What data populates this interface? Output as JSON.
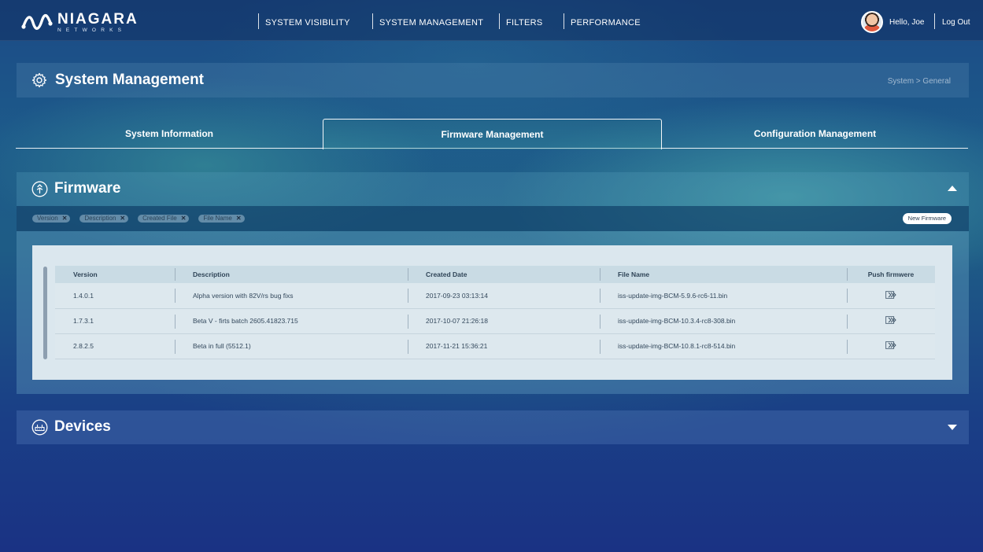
{
  "brand": {
    "name": "NIAGARA",
    "sub": "NETWORKS"
  },
  "nav": {
    "items": [
      "SYSTEM VISIBILITY",
      "SYSTEM MANAGEMENT",
      "FILTERS",
      "PERFORMANCE"
    ]
  },
  "user": {
    "greeting": "Hello, Joe",
    "logout": "Log Out"
  },
  "page": {
    "title": "System Management",
    "breadcrumb": "System > General"
  },
  "tabs": [
    "System Information",
    "Firmware Management",
    "Configuration Management"
  ],
  "active_tab": "Firmware Management",
  "firmware": {
    "title": "Firmware",
    "filters": [
      "Version",
      "Description",
      "Created File",
      "File Name"
    ],
    "new_button": "New Firmware",
    "columns": [
      "Version",
      "Description",
      "Created Date",
      "File Name",
      "Push firmwere"
    ],
    "rows": [
      {
        "version": "1.4.0.1",
        "description": "Alpha version with 82V/rs bug fixs",
        "created": "2017-09-23 03:13:14",
        "file": "iss-update-img-BCM-5.9.6-rc6-11.bin"
      },
      {
        "version": "1.7.3.1",
        "description": "Beta V - firts batch 2605.41823.715",
        "created": "2017-10-07 21:26:18",
        "file": "iss-update-img-BCM-10.3.4-rc8-308.bin"
      },
      {
        "version": "2.8.2.5",
        "description": "Beta in full (5512.1)",
        "created": "2017-11-21 15:36:21",
        "file": "iss-update-img-BCM-10.8.1-rc8-514.bin"
      }
    ]
  },
  "devices": {
    "title": "Devices"
  },
  "colors": {
    "accent": "#ffffff",
    "background": "#1b4a86",
    "table_bg": "#dbe7ee"
  }
}
